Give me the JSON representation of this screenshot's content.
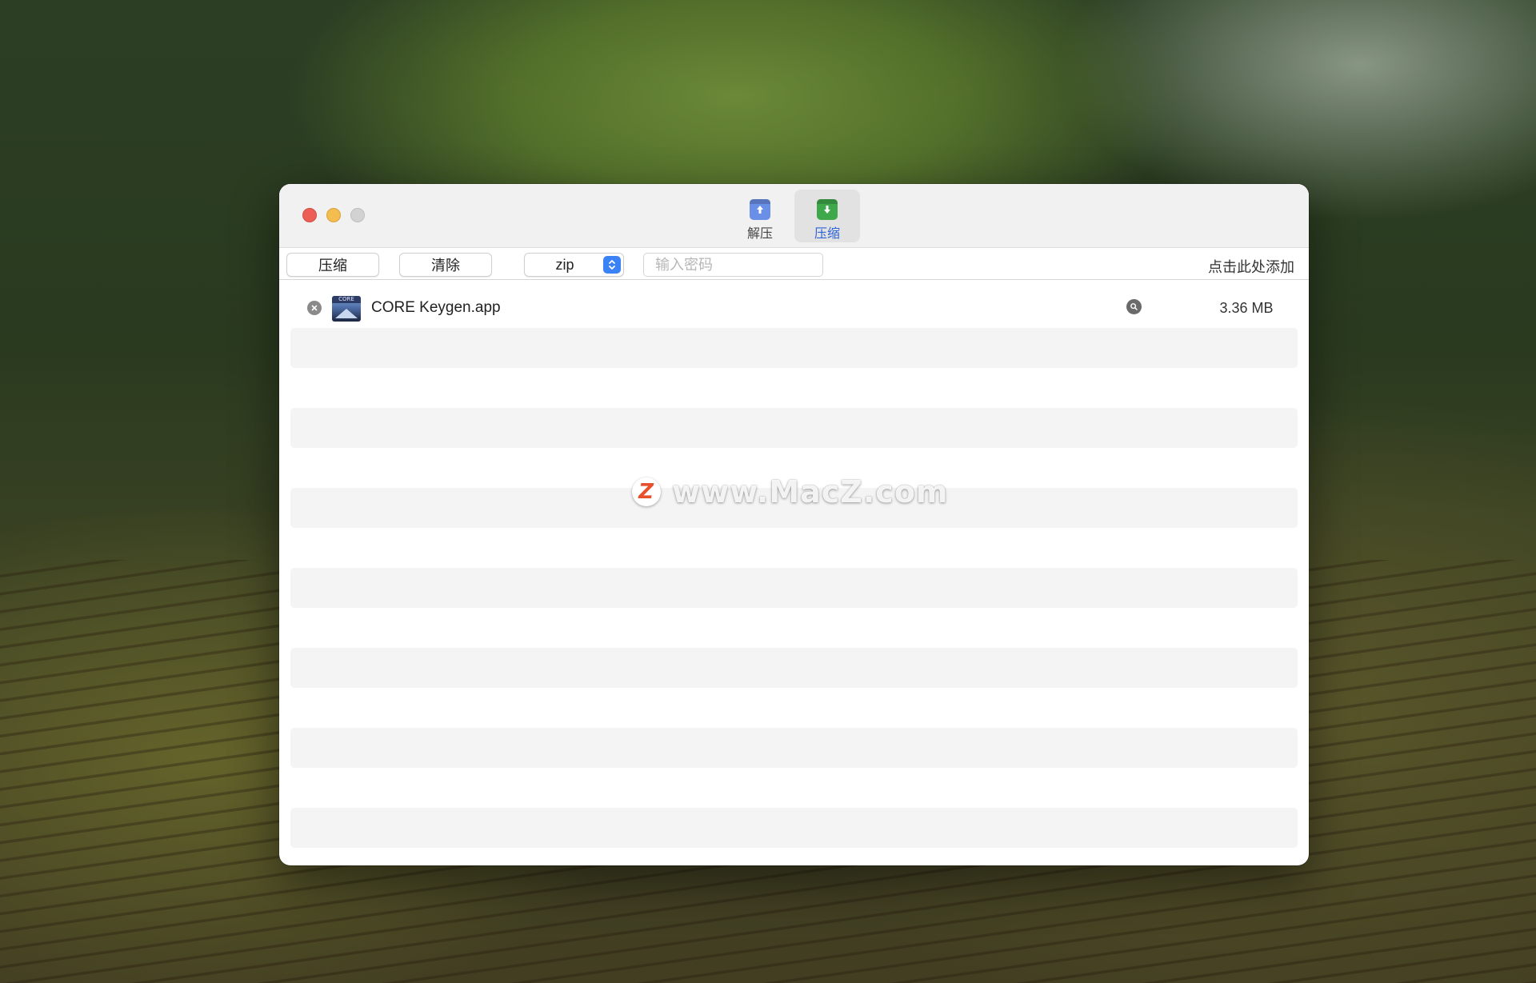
{
  "titlebar": {
    "tools": [
      {
        "label": "解压",
        "icon": "extract-icon",
        "color": "#6a8fe6",
        "active": false
      },
      {
        "label": "压缩",
        "icon": "compress-icon",
        "color": "#3fa84a",
        "active": true
      }
    ]
  },
  "toolbar": {
    "compress_label": "压缩",
    "clear_label": "清除",
    "format_value": "zip",
    "password_placeholder": "输入密码",
    "add_label": "点击此处添加"
  },
  "files": [
    {
      "name": "CORE Keygen.app",
      "size": "3.36 MB",
      "icon_text": "CORE"
    }
  ],
  "watermark": {
    "logo": "Z",
    "text": "www.MacZ.com"
  },
  "colors": {
    "accent": "#2c63d9",
    "stepper": "#3a82f6",
    "close": "#ec5f57",
    "minimize": "#f4bd4f",
    "maximize": "#d3d2d2"
  }
}
